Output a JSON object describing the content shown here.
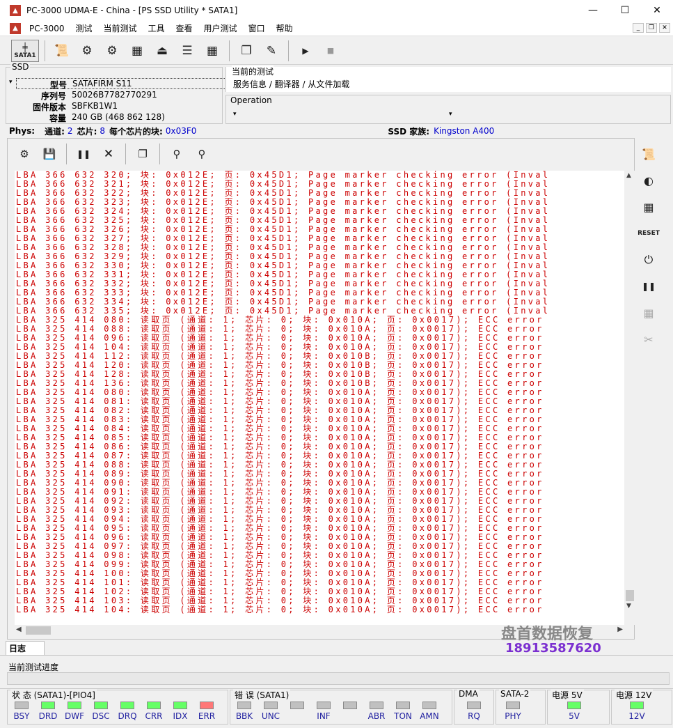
{
  "window": {
    "title": "PC-3000 UDMA-E - China - [PS SSD Utility * SATA1]",
    "minimize": "—",
    "maximize": "☐",
    "close": "✕"
  },
  "menu": [
    "PC-3000",
    "测试",
    "当前测试",
    "工具",
    "查看",
    "用户测试",
    "窗口",
    "帮助"
  ],
  "toolbar": {
    "sata_label": "SATA1"
  },
  "ssd": {
    "legend": "SSD",
    "model_k": "型号",
    "model_v": "SATAFIRM   S11",
    "serial_k": "序列号",
    "serial_v": "50026B7782770291",
    "fw_k": "固件版本",
    "fw_v": "SBFKB1W1",
    "cap_k": "容量",
    "cap_v": "240 GB (468 862 128)"
  },
  "current_test": {
    "label": "当前的测试",
    "value": "服务信息 / 翻译器 / 从文件加载"
  },
  "operation": {
    "label": "Operation"
  },
  "phys": {
    "label": "Phys:",
    "channels_k": "通道:",
    "channels_v": "2",
    "chips_k": "芯片:",
    "chips_v": "8",
    "blocks_k": "每个芯片的块:",
    "blocks_v": "0x03F0",
    "family_k": "SSD 家族:",
    "family_v": "Kingston A400"
  },
  "log_lines": [
    "LBA 366 632 320; 块: 0x012E; 页: 0x45D1; Page marker checking error (Inval",
    "LBA 366 632 321; 块: 0x012E; 页: 0x45D1; Page marker checking error (Inval",
    "LBA 366 632 322; 块: 0x012E; 页: 0x45D1; Page marker checking error (Inval",
    "LBA 366 632 323; 块: 0x012E; 页: 0x45D1; Page marker checking error (Inval",
    "LBA 366 632 324; 块: 0x012E; 页: 0x45D1; Page marker checking error (Inval",
    "LBA 366 632 325; 块: 0x012E; 页: 0x45D1; Page marker checking error (Inval",
    "LBA 366 632 326; 块: 0x012E; 页: 0x45D1; Page marker checking error (Inval",
    "LBA 366 632 327; 块: 0x012E; 页: 0x45D1; Page marker checking error (Inval",
    "LBA 366 632 328; 块: 0x012E; 页: 0x45D1; Page marker checking error (Inval",
    "LBA 366 632 329; 块: 0x012E; 页: 0x45D1; Page marker checking error (Inval",
    "LBA 366 632 330; 块: 0x012E; 页: 0x45D1; Page marker checking error (Inval",
    "LBA 366 632 331; 块: 0x012E; 页: 0x45D1; Page marker checking error (Inval",
    "LBA 366 632 332; 块: 0x012E; 页: 0x45D1; Page marker checking error (Inval",
    "LBA 366 632 333; 块: 0x012E; 页: 0x45D1; Page marker checking error (Inval",
    "LBA 366 632 334; 块: 0x012E; 页: 0x45D1; Page marker checking error (Inval",
    "LBA 366 632 335; 块: 0x012E; 页: 0x45D1; Page marker checking error (Inval",
    "LBA 325 414 080: 读取页 (通道: 1; 芯片: 0; 块: 0x010A; 页: 0x0017); ECC error",
    "LBA 325 414 088: 读取页 (通道: 1; 芯片: 0; 块: 0x010A; 页: 0x0017); ECC error",
    "LBA 325 414 096: 读取页 (通道: 1; 芯片: 0; 块: 0x010A; 页: 0x0017); ECC error",
    "LBA 325 414 104: 读取页 (通道: 1; 芯片: 0; 块: 0x010A; 页: 0x0017); ECC error",
    "LBA 325 414 112: 读取页 (通道: 1; 芯片: 0; 块: 0x010B; 页: 0x0017); ECC error",
    "LBA 325 414 120: 读取页 (通道: 1; 芯片: 0; 块: 0x010B; 页: 0x0017); ECC error",
    "LBA 325 414 128: 读取页 (通道: 1; 芯片: 0; 块: 0x010B; 页: 0x0017); ECC error",
    "LBA 325 414 136: 读取页 (通道: 1; 芯片: 0; 块: 0x010B; 页: 0x0017); ECC error",
    "LBA 325 414 080: 读取页 (通道: 1; 芯片: 0; 块: 0x010A; 页: 0x0017); ECC error",
    "LBA 325 414 081: 读取页 (通道: 1; 芯片: 0; 块: 0x010A; 页: 0x0017); ECC error",
    "LBA 325 414 082: 读取页 (通道: 1; 芯片: 0; 块: 0x010A; 页: 0x0017); ECC error",
    "LBA 325 414 083: 读取页 (通道: 1; 芯片: 0; 块: 0x010A; 页: 0x0017); ECC error",
    "LBA 325 414 084: 读取页 (通道: 1; 芯片: 0; 块: 0x010A; 页: 0x0017); ECC error",
    "LBA 325 414 085: 读取页 (通道: 1; 芯片: 0; 块: 0x010A; 页: 0x0017); ECC error",
    "LBA 325 414 086: 读取页 (通道: 1; 芯片: 0; 块: 0x010A; 页: 0x0017); ECC error",
    "LBA 325 414 087: 读取页 (通道: 1; 芯片: 0; 块: 0x010A; 页: 0x0017); ECC error",
    "LBA 325 414 088: 读取页 (通道: 1; 芯片: 0; 块: 0x010A; 页: 0x0017); ECC error",
    "LBA 325 414 089: 读取页 (通道: 1; 芯片: 0; 块: 0x010A; 页: 0x0017); ECC error",
    "LBA 325 414 090: 读取页 (通道: 1; 芯片: 0; 块: 0x010A; 页: 0x0017); ECC error",
    "LBA 325 414 091: 读取页 (通道: 1; 芯片: 0; 块: 0x010A; 页: 0x0017); ECC error",
    "LBA 325 414 092: 读取页 (通道: 1; 芯片: 0; 块: 0x010A; 页: 0x0017); ECC error",
    "LBA 325 414 093: 读取页 (通道: 1; 芯片: 0; 块: 0x010A; 页: 0x0017); ECC error",
    "LBA 325 414 094: 读取页 (通道: 1; 芯片: 0; 块: 0x010A; 页: 0x0017); ECC error",
    "LBA 325 414 095: 读取页 (通道: 1; 芯片: 0; 块: 0x010A; 页: 0x0017); ECC error",
    "LBA 325 414 096: 读取页 (通道: 1; 芯片: 0; 块: 0x010A; 页: 0x0017); ECC error",
    "LBA 325 414 097: 读取页 (通道: 1; 芯片: 0; 块: 0x010A; 页: 0x0017); ECC error",
    "LBA 325 414 098: 读取页 (通道: 1; 芯片: 0; 块: 0x010A; 页: 0x0017); ECC error",
    "LBA 325 414 099: 读取页 (通道: 1; 芯片: 0; 块: 0x010A; 页: 0x0017); ECC error",
    "LBA 325 414 100: 读取页 (通道: 1; 芯片: 0; 块: 0x010A; 页: 0x0017); ECC error",
    "LBA 325 414 101: 读取页 (通道: 1; 芯片: 0; 块: 0x010A; 页: 0x0017); ECC error",
    "LBA 325 414 102: 读取页 (通道: 1; 芯片: 0; 块: 0x010A; 页: 0x0017); ECC error",
    "LBA 325 414 103: 读取页 (通道: 1; 芯片: 0; 块: 0x010A; 页: 0x0017); ECC error",
    "LBA 325 414 104: 读取页 (通道: 1; 芯片: 0; 块: 0x010A; 页: 0x0017); ECC error"
  ],
  "log_color": "#cc0000",
  "watermark": {
    "line1": "盘首数据恢复",
    "line2": "18913587620"
  },
  "tab_log": "日志",
  "progress_label": "当前测试进度",
  "status_groups": {
    "state": {
      "label": "状 态 (SATA1)-[PIO4]",
      "leds": [
        {
          "n": "BSY",
          "s": "off"
        },
        {
          "n": "DRD",
          "s": "on"
        },
        {
          "n": "DWF",
          "s": "on"
        },
        {
          "n": "DSC",
          "s": "on"
        },
        {
          "n": "DRQ",
          "s": "on"
        },
        {
          "n": "CRR",
          "s": "on"
        },
        {
          "n": "IDX",
          "s": "on"
        },
        {
          "n": "ERR",
          "s": "err"
        }
      ]
    },
    "error": {
      "label": "错 误 (SATA1)",
      "leds": [
        {
          "n": "BBK",
          "s": "off"
        },
        {
          "n": "UNC",
          "s": "off"
        },
        {
          "n": "",
          "s": "off"
        },
        {
          "n": "INF",
          "s": "off"
        },
        {
          "n": "",
          "s": "off"
        },
        {
          "n": "ABR",
          "s": "off"
        },
        {
          "n": "TON",
          "s": "off"
        },
        {
          "n": "AMN",
          "s": "off"
        }
      ]
    },
    "dma": {
      "label": "DMA",
      "leds": [
        {
          "n": "RQ",
          "s": "off"
        }
      ]
    },
    "sata2": {
      "label": "SATA-2",
      "leds": [
        {
          "n": "PHY",
          "s": "off"
        }
      ]
    },
    "p5": {
      "label": "电源 5V",
      "leds": [
        {
          "n": "5V",
          "s": "on"
        }
      ]
    },
    "p12": {
      "label": "电源 12V",
      "leds": [
        {
          "n": "12V",
          "s": "on"
        }
      ]
    }
  }
}
